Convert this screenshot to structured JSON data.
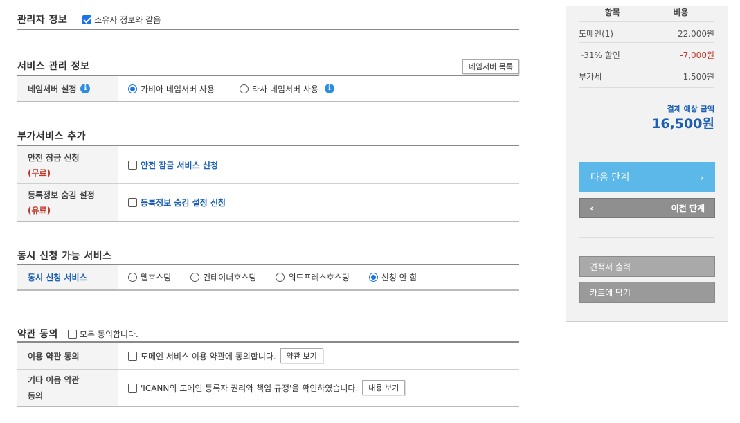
{
  "admin": {
    "title": "관리자 정보",
    "same_label": "소유자 정보와 같음"
  },
  "svc_mgmt": {
    "title": "서비스 관리 정보",
    "ns_list_button": "네임서버 목록",
    "ns_label": "네임서버 설정",
    "opt_gabia": "가비아 네임서버 사용",
    "opt_other": "타사 네임서버 사용"
  },
  "addon": {
    "title": "부가서비스 추가",
    "lock_label": "안전 잠금 신청",
    "lock_price": "(무료)",
    "lock_option": "안전 잠금 서비스 신청",
    "hide_label": "등록정보 숨김 설정",
    "hide_price": "(유료)",
    "hide_option": "등록정보 숨김 설정 신청"
  },
  "concurrent": {
    "title": "동시 신청 가능 서비스",
    "label": "동시 신청 서비스",
    "options": [
      "웹호스팅",
      "컨테이너호스팅",
      "워드프레스호스팅",
      "신청 안 함"
    ]
  },
  "terms": {
    "title": "약관 동의",
    "all_agree": "모두 동의합니다.",
    "use_label": "이용 약관 동의",
    "use_text": "도메인 서비스 이용 약관에 동의합니다.",
    "use_button": "약관 보기",
    "other_label_1": "기타 이용 약관",
    "other_label_2": "동의",
    "other_text": "'ICANN의 도메인 등록자 권리와 책임 규정'을 확인하였습니다.",
    "other_button": "내용 보기"
  },
  "side": {
    "col_item": "항목",
    "col_cost": "비용",
    "rows": [
      {
        "label": "도메인(1)",
        "value": "22,000원"
      },
      {
        "label": "└31% 할인",
        "value": "-7,000원"
      },
      {
        "label": "부가세",
        "value": "1,500원"
      }
    ],
    "total_label": "결제 예상 금액",
    "total_value": "16,500원",
    "next_button": "다음 단계",
    "prev_button": "이전 단계",
    "quote_button": "견적서 출력",
    "cart_button": "카트에 담기",
    "next_icon": "chevron-right-icon",
    "prev_icon": "chevron-left-icon"
  },
  "colors": {
    "accent": "#1a73e8",
    "link_blue": "#1a5fb4",
    "discount_red": "#c0392b",
    "next_btn": "#5bb8e8"
  }
}
